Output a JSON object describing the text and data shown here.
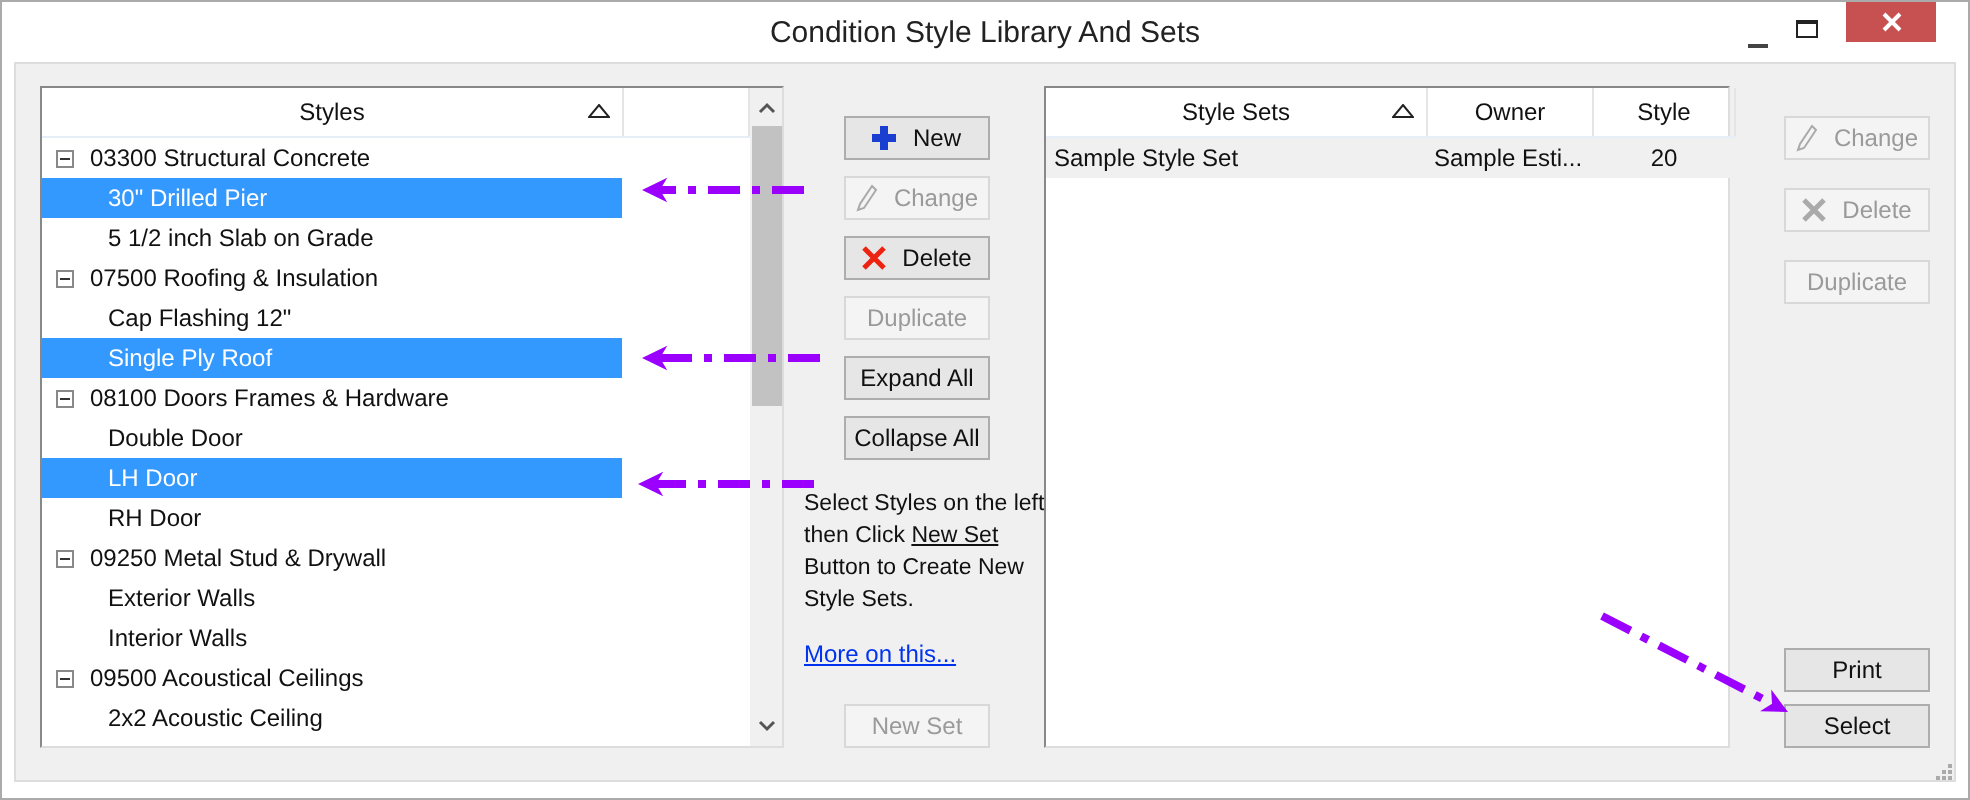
{
  "window": {
    "title": "Condition Style Library And Sets"
  },
  "styles_list": {
    "columns": [
      "Styles"
    ],
    "sorted_ascending": true,
    "groups": [
      {
        "label": "03300  Structural Concrete",
        "expanded": true,
        "children": [
          {
            "label": "30\" Drilled Pier",
            "selected": true
          },
          {
            "label": "5 1/2 inch Slab on Grade",
            "selected": false
          }
        ]
      },
      {
        "label": "07500  Roofing & Insulation",
        "expanded": true,
        "children": [
          {
            "label": "Cap Flashing 12\"",
            "selected": false
          },
          {
            "label": "Single Ply Roof",
            "selected": true
          }
        ]
      },
      {
        "label": "08100  Doors Frames & Hardware",
        "expanded": true,
        "children": [
          {
            "label": "Double Door",
            "selected": false
          },
          {
            "label": "LH Door",
            "selected": true
          },
          {
            "label": "RH Door",
            "selected": false
          }
        ]
      },
      {
        "label": "09250  Metal Stud & Drywall",
        "expanded": true,
        "children": [
          {
            "label": "Exterior Walls",
            "selected": false
          },
          {
            "label": "Interior  Walls",
            "selected": false
          }
        ]
      },
      {
        "label": "09500  Acoustical Ceilings",
        "expanded": true,
        "children": [
          {
            "label": "2x2 Acoustic Ceiling",
            "selected": false
          }
        ]
      }
    ]
  },
  "middle_buttons": [
    {
      "label": "New",
      "kind": "new",
      "disabled": false
    },
    {
      "label": "Change",
      "kind": "change",
      "disabled": true
    },
    {
      "label": "Delete",
      "kind": "delete",
      "disabled": false
    },
    {
      "label": "Duplicate",
      "kind": "plain",
      "disabled": true
    },
    {
      "label": "Expand All",
      "kind": "plain",
      "disabled": false
    },
    {
      "label": "Collapse All",
      "kind": "plain",
      "disabled": false
    }
  ],
  "hint": {
    "before": "Select Styles on the left then Click  ",
    "link": "New Set",
    "after": " Button to Create New Style Sets."
  },
  "more_link": "More on this...",
  "new_set_button": {
    "label": "New Set",
    "disabled": true
  },
  "sets_table": {
    "columns": [
      "Style Sets",
      "Owner",
      "Style"
    ],
    "sorted_ascending": true,
    "rows": [
      {
        "cells": [
          "Sample Style Set",
          "Sample Esti...",
          "20"
        ],
        "selected": false
      }
    ]
  },
  "right_buttons": [
    {
      "label": "Change",
      "kind": "change",
      "disabled": true
    },
    {
      "label": "Delete",
      "kind": "delete",
      "disabled": true
    },
    {
      "label": "Duplicate",
      "kind": "plain",
      "disabled": true
    }
  ],
  "bottom_buttons": [
    {
      "label": "Print",
      "disabled": false
    },
    {
      "label": "Select",
      "disabled": false
    }
  ]
}
